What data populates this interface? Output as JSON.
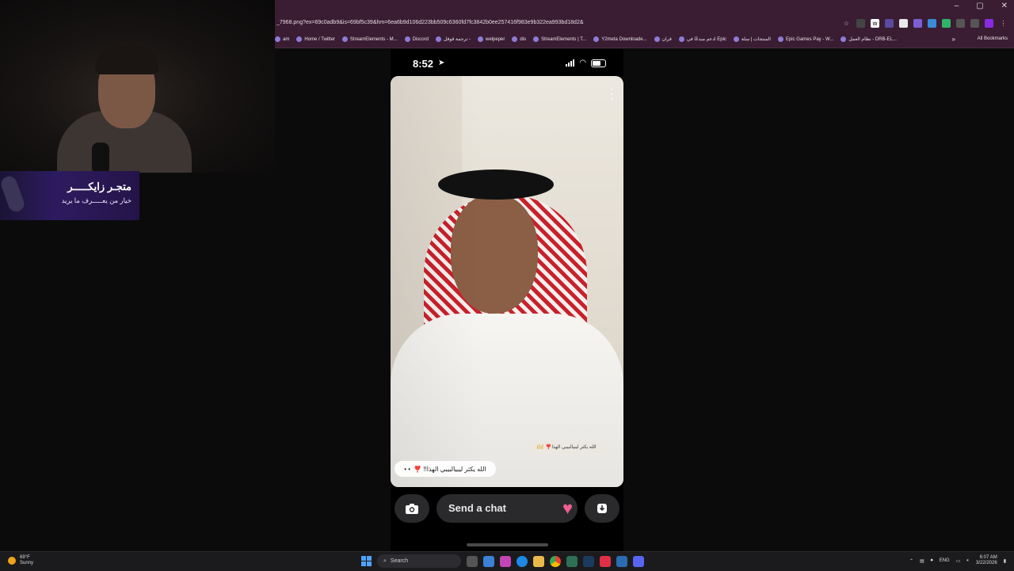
{
  "browser": {
    "url": "_7968.png?ex=69c0adb9&is=69bf5c39&hm=6ea6b9d106d223bb509c6360fd7fc3842b0ee257416f983e9b322ea993bd18d2&",
    "window_controls": [
      "–",
      "▢",
      "✕"
    ],
    "bookmarks": [
      {
        "label": "am",
        "icon": "bookmark-icon"
      },
      {
        "label": "Home / Twitter",
        "icon": "x-icon"
      },
      {
        "label": "StreamElements - M...",
        "icon": "streamelements-icon"
      },
      {
        "label": "Discord",
        "icon": "discord-icon"
      },
      {
        "label": "ترجمة قوقل -",
        "icon": "google-icon"
      },
      {
        "label": "welpeper",
        "icon": "pin-icon"
      },
      {
        "label": "dis",
        "icon": "discord-icon"
      },
      {
        "label": "StreamElements | T...",
        "icon": "streamelements-icon"
      },
      {
        "label": "Y2meta Downloade...",
        "icon": "download-icon"
      },
      {
        "label": "قران",
        "icon": "book-icon"
      },
      {
        "label": "ادعم مبدعًا في Epic",
        "icon": "epic-icon"
      },
      {
        "label": "المنتجات | سلة",
        "icon": "cart-icon"
      },
      {
        "label": "Epic Games Pay - W...",
        "icon": "epic-icon"
      },
      {
        "label": "نظام العمل - DRB-EL...",
        "icon": "doc-icon"
      }
    ],
    "all_bookmarks": "All Bookmarks",
    "more": "»"
  },
  "overlay": {
    "banner_title": "متجـر زايكـــــر",
    "banner_subtitle": "خيار من يعـــــرف ما يريد"
  },
  "phone": {
    "time": "8:52",
    "snap": {
      "reply_badge": "الله يكثر ليبيالبيبي الهذا❣️",
      "caption": "الله يكثر ليبيالبيبي الهذا!! ❣️",
      "caption_dots": "• •"
    },
    "chat_placeholder": "Send a chat"
  },
  "taskbar": {
    "weather_temp": "69°F",
    "weather_desc": "Sunny",
    "search_label": "Search",
    "lang": "ENG",
    "time": "6:07 AM",
    "date": "3/22/2026"
  },
  "colors": {
    "browser_chrome": "#3a1d33",
    "banner": "#2d1b5f",
    "chat_heart": "#ef5f8f"
  }
}
